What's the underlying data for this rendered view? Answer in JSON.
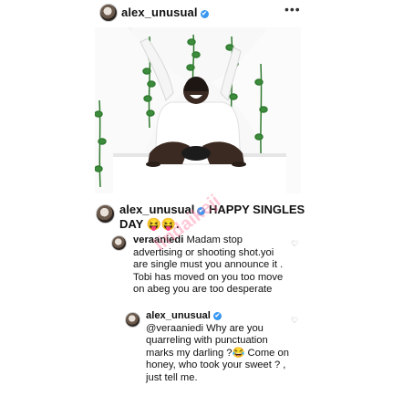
{
  "post": {
    "username": "alex_unusual",
    "verified_mark": "✔",
    "more_icon": "•••"
  },
  "caption": {
    "username": "alex_unusual",
    "text": "HAPPY SINGLES DAY 😝😝."
  },
  "comments": [
    {
      "username": "veraaniedi",
      "text": "Madam stop advertising or shooting shot.yoi are single must you announce it . Tobi has moved on you too move on abeg you are too desperate",
      "heart_icon": "♡"
    },
    {
      "username": "alex_unusual",
      "mention": "@veraaniedi",
      "text": "Why are you quarreling with punctuation marks my darling ?😂 Come on honey, who took your sweet ? , just tell me.",
      "heart_icon": "♡"
    }
  ],
  "watermark": "lindaikeji"
}
